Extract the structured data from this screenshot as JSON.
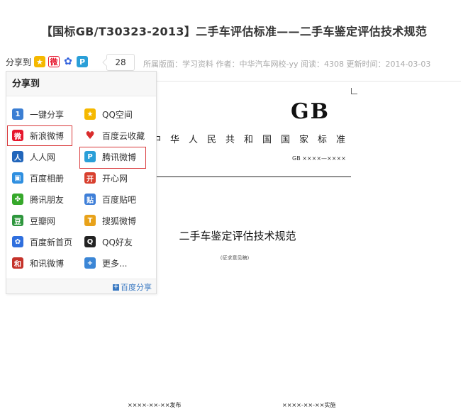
{
  "article": {
    "title": "【国标GB/T30323-2013】二手车评估标准——二手车鉴定评估技术规范",
    "meta": "所属版面：学习资料 作者：中华汽车网校-yy 阅读：4308 更新时间：2014-03-03"
  },
  "sharebar": {
    "label": "分享到",
    "count": "28",
    "icons": [
      "qzone-icon",
      "weibo-icon",
      "baidu-icon",
      "tencent-weibo-icon"
    ]
  },
  "share_popup": {
    "header": "分享到",
    "left_items": [
      {
        "label": "一键分享",
        "icon": "one-click-share-icon",
        "color": "#3b7ed3"
      },
      {
        "label": "新浪微博",
        "icon": "sina-weibo-icon",
        "color": "#e6162d"
      },
      {
        "label": "人人网",
        "icon": "renren-icon",
        "color": "#2266bb"
      },
      {
        "label": "百度相册",
        "icon": "baidu-album-icon",
        "color": "#2f8fe0"
      },
      {
        "label": "腾讯朋友",
        "icon": "tencent-pengyou-icon",
        "color": "#36a82b"
      },
      {
        "label": "豆瓣网",
        "icon": "douban-icon",
        "color": "#2e963d"
      },
      {
        "label": "百度新首页",
        "icon": "baidu-homepage-icon",
        "color": "#2f6fde"
      },
      {
        "label": "和讯微博",
        "icon": "hexun-weibo-icon",
        "color": "#c5322a"
      }
    ],
    "right_items": [
      {
        "label": "QQ空间",
        "icon": "qzone-icon",
        "color": "#f5b800"
      },
      {
        "label": "百度云收藏",
        "icon": "heart-icon",
        "color": "#d92c2c"
      },
      {
        "label": "腾讯微博",
        "icon": "tencent-weibo-icon",
        "color": "#2a9fd8"
      },
      {
        "label": "开心网",
        "icon": "kaixin-icon",
        "color": "#d8402f"
      },
      {
        "label": "百度贴吧",
        "icon": "tieba-icon",
        "color": "#3f7fd8"
      },
      {
        "label": "搜狐微博",
        "icon": "sohu-weibo-icon",
        "color": "#e8a21a"
      },
      {
        "label": "QQ好友",
        "icon": "qq-penguin-icon",
        "color": "#222222"
      },
      {
        "label": "更多...",
        "icon": "plus-icon",
        "color": "#3b86d6"
      }
    ],
    "footer": "百度分享"
  },
  "document": {
    "code": "GB",
    "national_standard": "中华人民共和国国家标准",
    "standard_number": "GB ××××—××××",
    "doc_title": "二手车鉴定评估技术规范",
    "draft_note": "(征求意见稿)",
    "published": "××××-××-××发布",
    "implemented": "××××-××-××实施"
  }
}
